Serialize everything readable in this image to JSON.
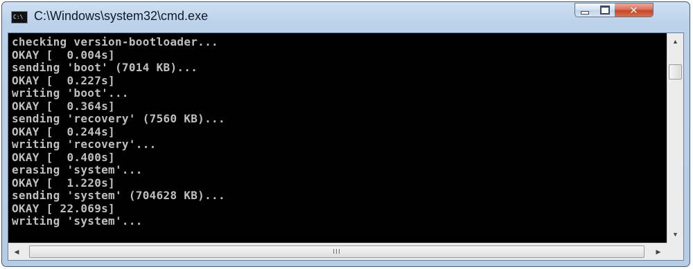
{
  "window": {
    "title": "C:\\Windows\\system32\\cmd.exe",
    "icon_label": "C:\\"
  },
  "controls": {
    "minimize": "minimize-icon",
    "maximize": "maximize-icon",
    "close": "close-icon"
  },
  "console": {
    "lines": [
      "checking version-bootloader...",
      "OKAY [  0.004s]",
      "sending 'boot' (7014 KB)...",
      "OKAY [  0.227s]",
      "writing 'boot'...",
      "OKAY [  0.364s]",
      "sending 'recovery' (7560 KB)...",
      "OKAY [  0.244s]",
      "writing 'recovery'...",
      "OKAY [  0.400s]",
      "erasing 'system'...",
      "OKAY [  1.220s]",
      "sending 'system' (704628 KB)...",
      "OKAY [ 22.069s]",
      "writing 'system'..."
    ]
  },
  "scrollbars": {
    "grip": "III",
    "up": "▲",
    "down": "▼",
    "left": "◀",
    "right": "▶"
  }
}
